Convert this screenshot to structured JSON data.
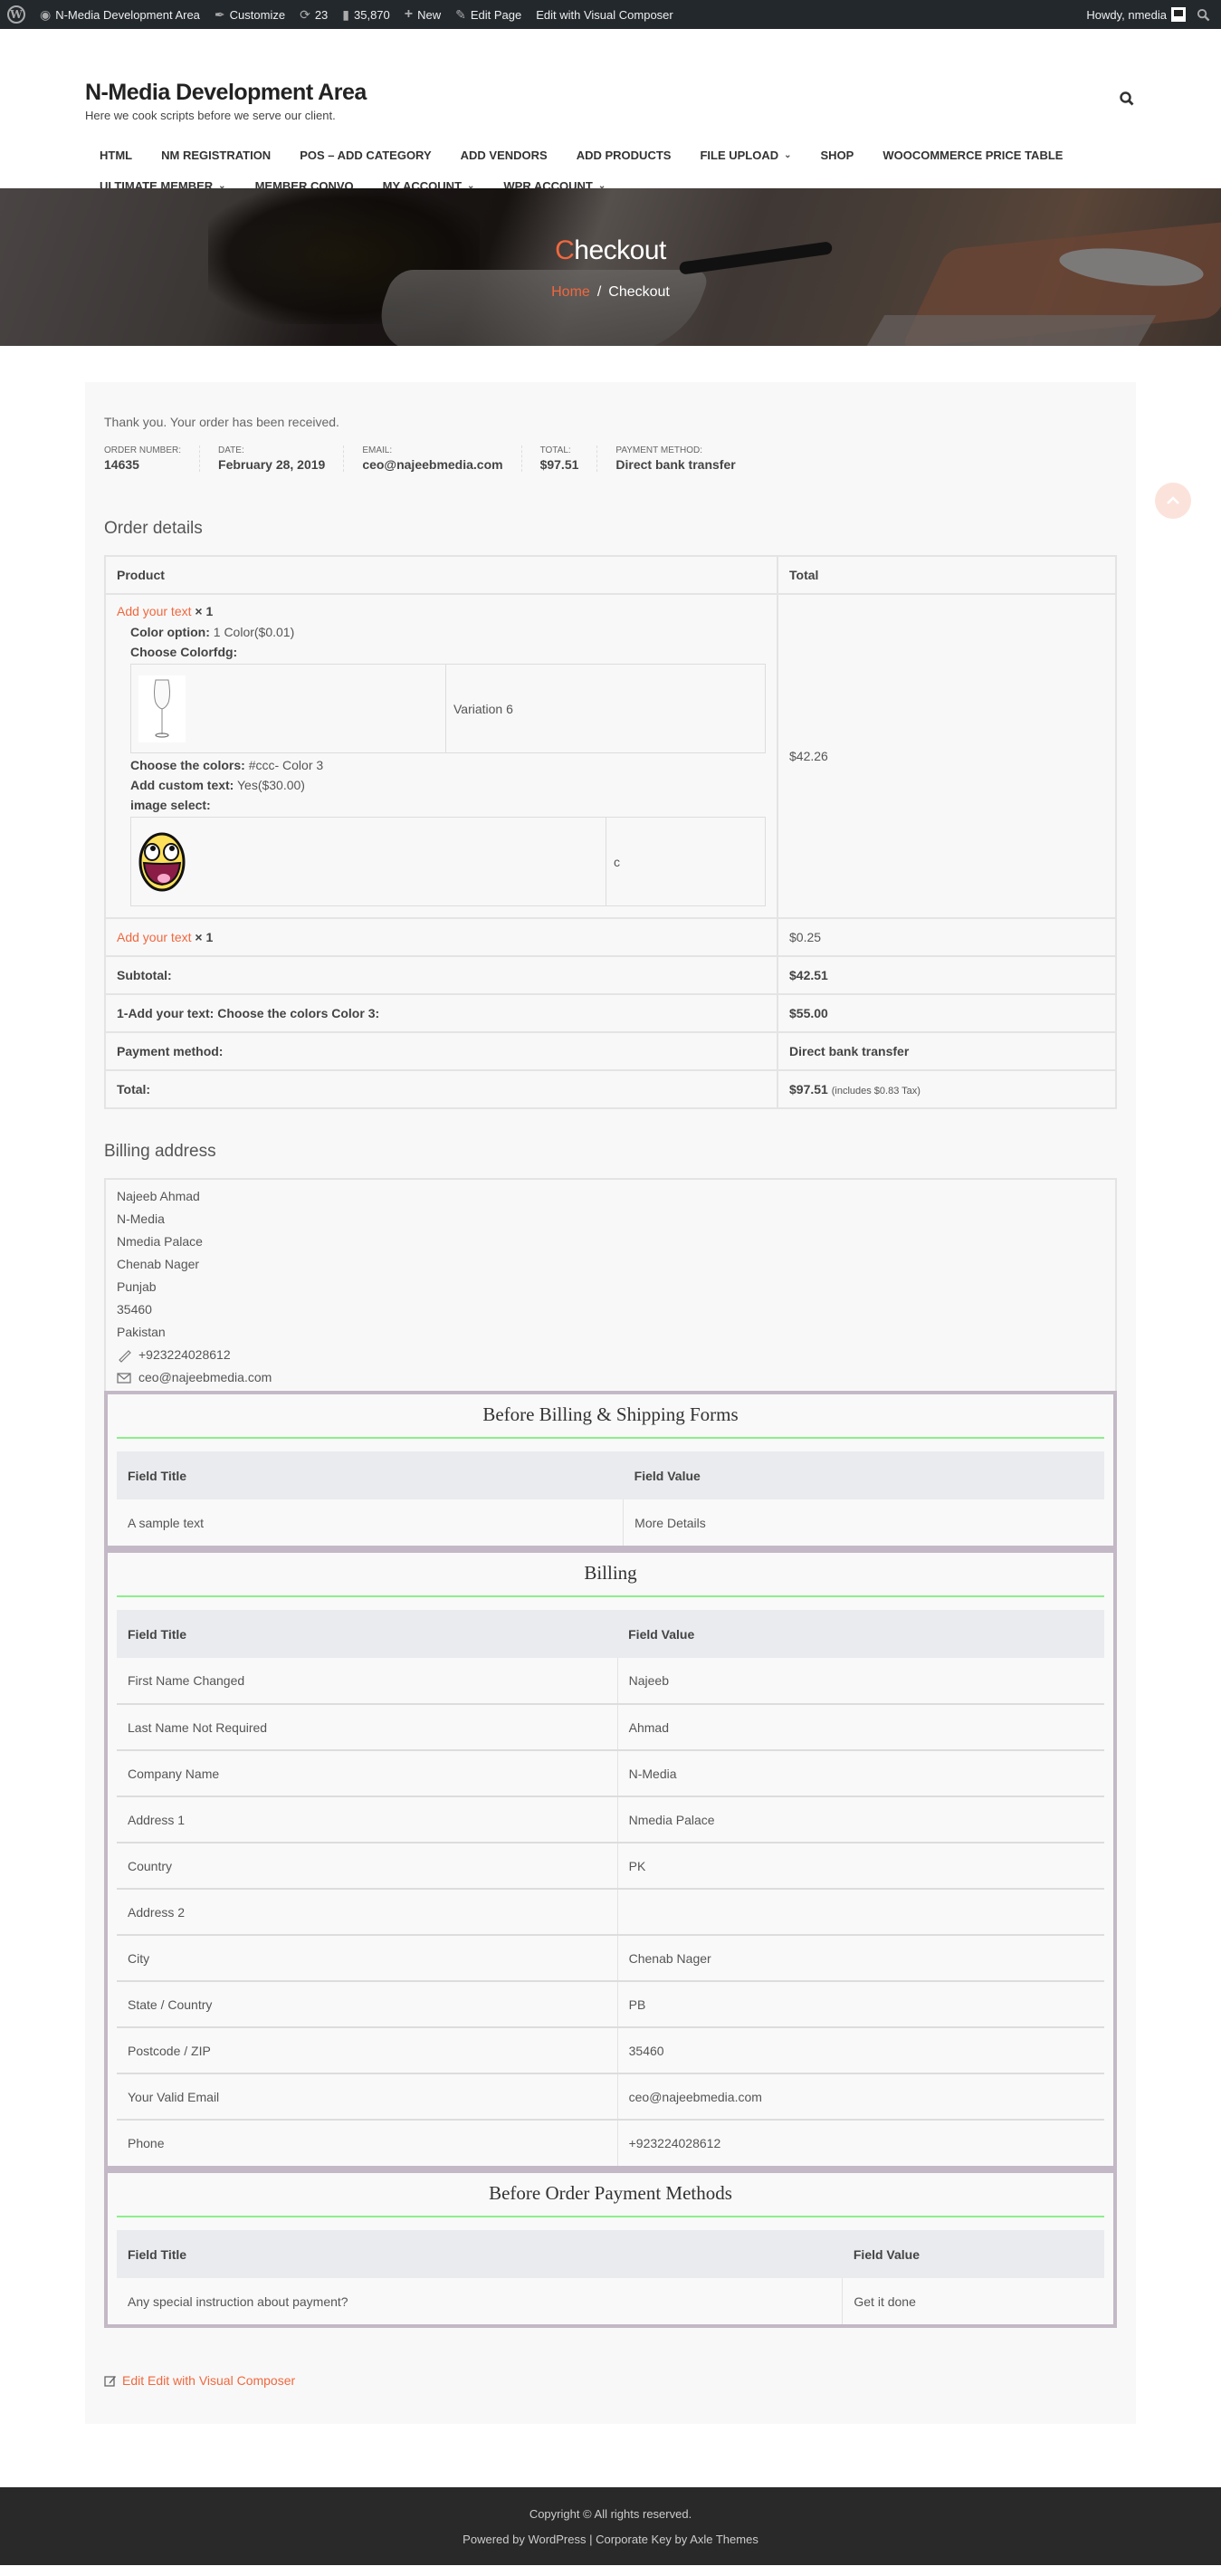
{
  "adminbar": {
    "site_name": "N-Media Development Area",
    "customize": "Customize",
    "updates_count": "23",
    "comments_count": "35,870",
    "new_label": "New",
    "edit_page": "Edit Page",
    "edit_vc": "Edit with Visual Composer",
    "howdy": "Howdy, nmedia"
  },
  "header": {
    "site_title": "N-Media Development Area",
    "tagline": "Here we cook scripts before we serve our client."
  },
  "nav": {
    "row1": [
      {
        "label": "HTML",
        "has_dropdown": false
      },
      {
        "label": "NM REGISTRATION",
        "has_dropdown": false
      },
      {
        "label": "POS – ADD CATEGORY",
        "has_dropdown": false
      },
      {
        "label": "ADD VENDORS",
        "has_dropdown": false
      },
      {
        "label": "ADD PRODUCTS",
        "has_dropdown": false
      },
      {
        "label": "FILE UPLOAD",
        "has_dropdown": true
      },
      {
        "label": "SHOP",
        "has_dropdown": false
      },
      {
        "label": "WOOCOMMERCE PRICE TABLE",
        "has_dropdown": false
      }
    ],
    "row2": [
      {
        "label": "ULTIMATE MEMBER",
        "has_dropdown": true
      },
      {
        "label": "MEMBER CONVO",
        "has_dropdown": false
      },
      {
        "label": "MY ACCOUNT",
        "has_dropdown": true
      },
      {
        "label": "WPR ACCOUNT",
        "has_dropdown": true
      }
    ]
  },
  "hero": {
    "title_first": "C",
    "title_rest": "heckout",
    "breadcrumb_home": "Home",
    "breadcrumb_sep": "/",
    "breadcrumb_current": "Checkout"
  },
  "order": {
    "thank_you": "Thank you. Your order has been received.",
    "overview": [
      {
        "label": "ORDER NUMBER:",
        "value": "14635"
      },
      {
        "label": "DATE:",
        "value": "February 28, 2019"
      },
      {
        "label": "EMAIL:",
        "value": "ceo@najeebmedia.com"
      },
      {
        "label": "TOTAL:",
        "value": "$97.51"
      },
      {
        "label": "PAYMENT METHOD:",
        "value": "Direct bank transfer"
      }
    ],
    "details_title": "Order details",
    "table_headers": {
      "product": "Product",
      "total": "Total"
    },
    "item1": {
      "name": "Add your text",
      "qty": "× 1",
      "total": "$42.26",
      "meta": {
        "color_option_label": "Color option:",
        "color_option_value": "1 Color($0.01)",
        "choose_colorfdg_label": "Choose Colorfdg:",
        "variation_label": "Variation 6",
        "choose_colors_label": "Choose the colors:",
        "choose_colors_value": "#ccc- Color 3",
        "custom_text_label": "Add custom text:",
        "custom_text_value": "Yes($30.00)",
        "image_select_label": "image select:",
        "image_select_value": "c"
      }
    },
    "item2": {
      "name": "Add your text",
      "qty": "× 1",
      "total": "$0.25"
    },
    "totals": [
      {
        "label": "Subtotal:",
        "value": "$42.51"
      },
      {
        "label": "1-Add your text: Choose the colors Color 3:",
        "value": "$55.00"
      },
      {
        "label": "Payment method:",
        "value": "Direct bank transfer"
      }
    ],
    "grand_total_label": "Total:",
    "grand_total_value": "$97.51",
    "grand_total_tax": "(includes $0.83 Tax)"
  },
  "billing": {
    "title": "Billing address",
    "lines": [
      "Najeeb Ahmad",
      "N-Media",
      "Nmedia Palace",
      "Chenab Nager",
      "Punjab",
      "35460",
      "Pakistan"
    ],
    "phone": "+923224028612",
    "email": "ceo@najeebmedia.com"
  },
  "custom_sections": {
    "before_billing": {
      "title": "Before Billing & Shipping Forms",
      "headers": [
        "Field Title",
        "Field Value"
      ],
      "rows": [
        [
          "A sample text",
          "More Details"
        ]
      ]
    },
    "billing": {
      "title": "Billing",
      "headers": [
        "Field Title",
        "Field Value"
      ],
      "rows": [
        [
          "First Name Changed",
          "Najeeb"
        ],
        [
          "Last Name Not Required",
          "Ahmad"
        ],
        [
          "Company Name",
          "N-Media"
        ],
        [
          "Address 1",
          "Nmedia Palace"
        ],
        [
          "Country",
          "PK"
        ],
        [
          "Address 2",
          ""
        ],
        [
          "City",
          "Chenab Nager"
        ],
        [
          "State / Country",
          "PB"
        ],
        [
          "Postcode / ZIP",
          "35460"
        ],
        [
          "Your Valid Email",
          "ceo@najeebmedia.com"
        ],
        [
          "Phone",
          "+923224028612"
        ]
      ]
    },
    "before_payment": {
      "title": "Before Order Payment Methods",
      "headers": [
        "Field Title",
        "Field Value"
      ],
      "rows": [
        [
          "Any special instruction about payment?",
          "Get it done"
        ]
      ]
    }
  },
  "edit_link": "Edit Edit with Visual Composer",
  "footer": {
    "copyright": "Copyright © All rights reserved.",
    "powered_prefix": "Powered by ",
    "powered_wp": "WordPress",
    "powered_sep": " | ",
    "theme": "Corporate Key",
    "by": " by ",
    "author": "Axle Themes"
  },
  "colors": {
    "accent": "#f0683e",
    "adminbar_bg": "#23282d",
    "section_rule": "#8bef8b",
    "section_border": "#c3b9c6",
    "footer_bg": "#292929"
  }
}
